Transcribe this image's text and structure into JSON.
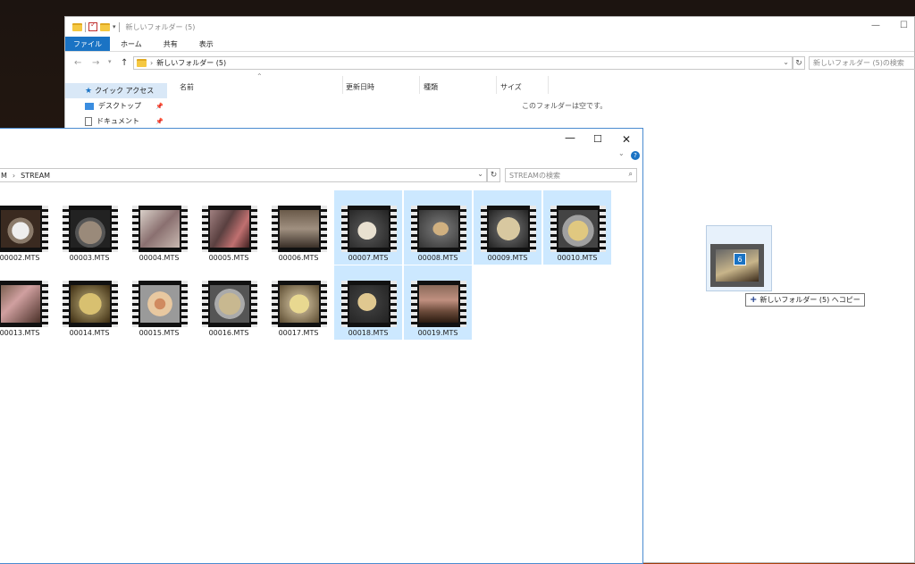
{
  "back_window": {
    "title": "新しいフォルダー (5)",
    "ribbon": {
      "file": "ファイル",
      "home": "ホーム",
      "share": "共有",
      "view": "表示"
    },
    "address": "新しいフォルダー (5)",
    "search_placeholder": "新しいフォルダー (5)の検索",
    "nav": [
      {
        "label": "クイック アクセス"
      },
      {
        "label": "デスクトップ"
      },
      {
        "label": "ドキュメント"
      }
    ],
    "columns": {
      "name": "名前",
      "date": "更新日時",
      "type": "種類",
      "size": "サイズ"
    },
    "empty_message": "このフォルダーは空です。"
  },
  "front_window": {
    "breadcrumb": {
      "parent": "M",
      "separator": "›",
      "current": "STREAM"
    },
    "search_placeholder": "STREAMの検索",
    "files": [
      {
        "name": "00002.MTS",
        "selected": false
      },
      {
        "name": "00003.MTS",
        "selected": false
      },
      {
        "name": "00004.MTS",
        "selected": false
      },
      {
        "name": "00005.MTS",
        "selected": false
      },
      {
        "name": "00006.MTS",
        "selected": false
      },
      {
        "name": "00007.MTS",
        "selected": true
      },
      {
        "name": "00008.MTS",
        "selected": true
      },
      {
        "name": "00009.MTS",
        "selected": true
      },
      {
        "name": "00010.MTS",
        "selected": true
      },
      {
        "name": "00013.MTS",
        "selected": false
      },
      {
        "name": "00014.MTS",
        "selected": false
      },
      {
        "name": "00015.MTS",
        "selected": false
      },
      {
        "name": "00016.MTS",
        "selected": false
      },
      {
        "name": "00017.MTS",
        "selected": false
      },
      {
        "name": "00018.MTS",
        "selected": true
      },
      {
        "name": "00019.MTS",
        "selected": true
      }
    ]
  },
  "drag": {
    "count": "6",
    "tooltip": "新しいフォルダー (5) へコピー"
  },
  "icons": {
    "back": "back-arrow-icon",
    "forward": "forward-arrow-icon",
    "up": "up-arrow-icon",
    "refresh": "refresh-icon",
    "search": "search-icon",
    "help": "help-icon",
    "pin": "pin-icon"
  },
  "colors": {
    "accent": "#1a73c4",
    "selection": "#cce8ff"
  }
}
